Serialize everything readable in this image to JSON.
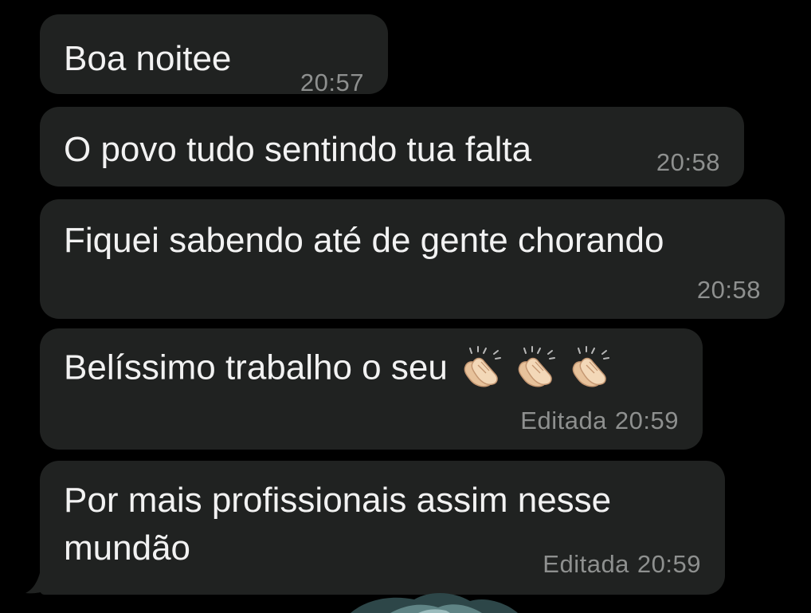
{
  "messages": [
    {
      "text": "Boa noitee",
      "time": "20:57",
      "edited_label": ""
    },
    {
      "text": "O povo tudo sentindo tua falta",
      "time": "20:58",
      "edited_label": ""
    },
    {
      "text": "Fiquei sabendo até de gente chorando",
      "time": "20:58",
      "edited_label": ""
    },
    {
      "text": "Belíssimo trabalho o seu",
      "emojis": [
        "clapping-hands-icon",
        "clapping-hands-icon",
        "clapping-hands-icon"
      ],
      "time": "20:59",
      "edited_label": "Editada"
    },
    {
      "text": "Por mais profissionais assim nesse mundão",
      "time": "20:59",
      "edited_label": "Editada"
    }
  ],
  "colors": {
    "background": "#000000",
    "bubble": "#202221",
    "text": "#f2f2f2",
    "meta": "#8e908f"
  }
}
